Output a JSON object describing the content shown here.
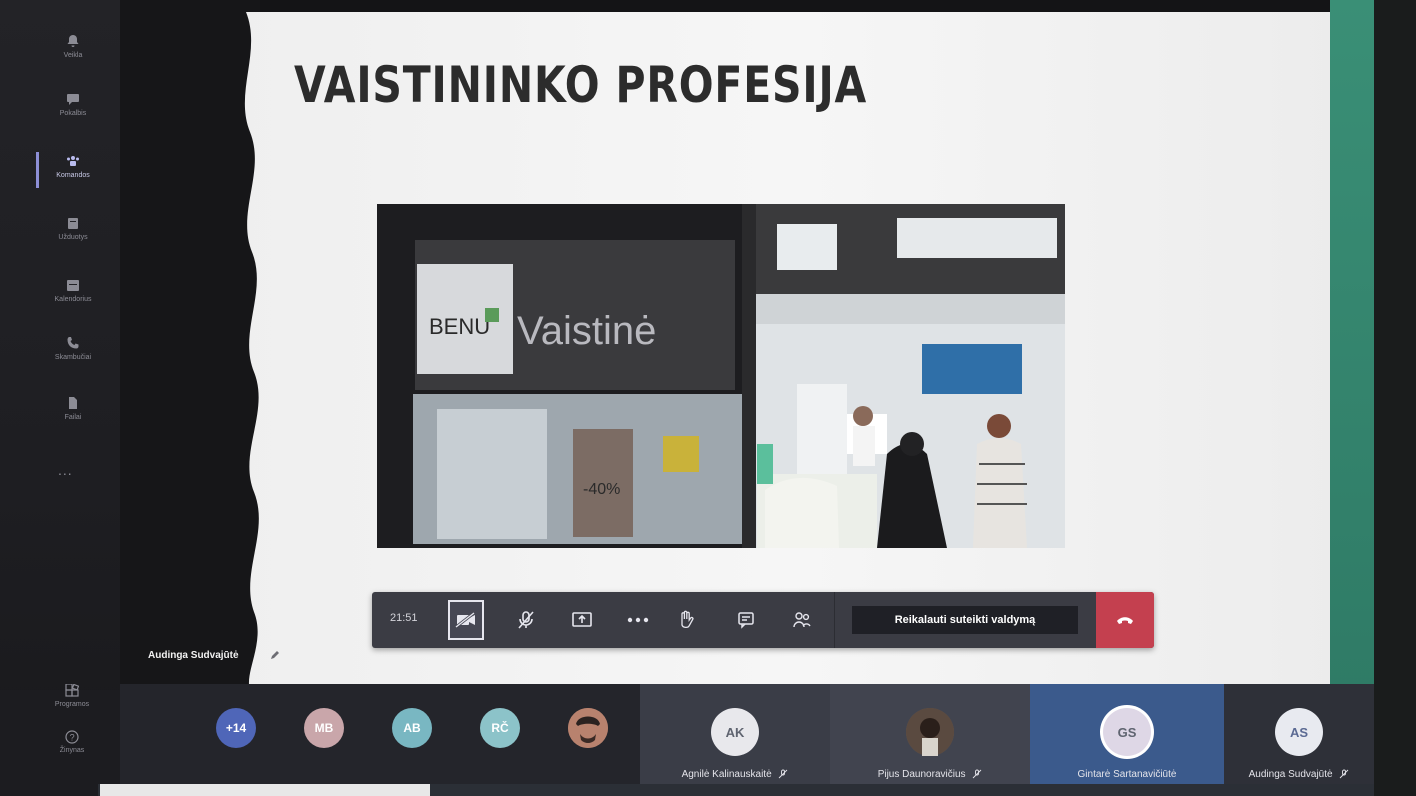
{
  "rail": {
    "items": [
      {
        "label": "Veikla",
        "icon": "bell-icon"
      },
      {
        "label": "Pokalbis",
        "icon": "chat-icon"
      },
      {
        "label": "Komandos",
        "icon": "teams-icon"
      },
      {
        "label": "Užduotys",
        "icon": "assignments-icon"
      },
      {
        "label": "Kalendorius",
        "icon": "calendar-icon"
      },
      {
        "label": "Skambučiai",
        "icon": "phone-icon"
      },
      {
        "label": "Failai",
        "icon": "files-icon"
      }
    ],
    "more": "...",
    "bottom": [
      {
        "label": "Programos",
        "icon": "apps-icon"
      },
      {
        "label": "Žinynas",
        "icon": "help-icon"
      }
    ]
  },
  "slide": {
    "title": "VAISTININKO PROFESIJA",
    "photo": {
      "sign_text": "Vaistinė",
      "logo_text": "BENU",
      "price_text": "-40%"
    }
  },
  "presenter": {
    "name": "Audinga Sudvajūtė"
  },
  "controls": {
    "time": "21:51",
    "request_control_label": "Reikalauti suteikti valdymą",
    "colors": {
      "bar": "#3b3c44",
      "hangup": "#c4404f"
    }
  },
  "participants": {
    "small_avatars": [
      {
        "initials": "+14",
        "color": "#4f66b8"
      },
      {
        "initials": "MB",
        "color": "#c9a6aa"
      },
      {
        "initials": "AB",
        "color": "#79b7c2"
      },
      {
        "initials": "RČ",
        "color": "#8cc3c9"
      },
      {
        "initials": "",
        "color": "#a17060",
        "photo": true
      }
    ],
    "tiles": [
      {
        "name": "Agnilė Kalinauskaitė",
        "initials": "AK",
        "muted": true
      },
      {
        "name": "Pijus Daunoravičius",
        "initials": "",
        "muted": true,
        "photo": true
      },
      {
        "name": "Gintarė Sartanavičiūtė",
        "initials": "GS",
        "muted": false
      },
      {
        "name": "Audinga Sudvajūtė",
        "initials": "AS",
        "muted": true
      }
    ]
  }
}
